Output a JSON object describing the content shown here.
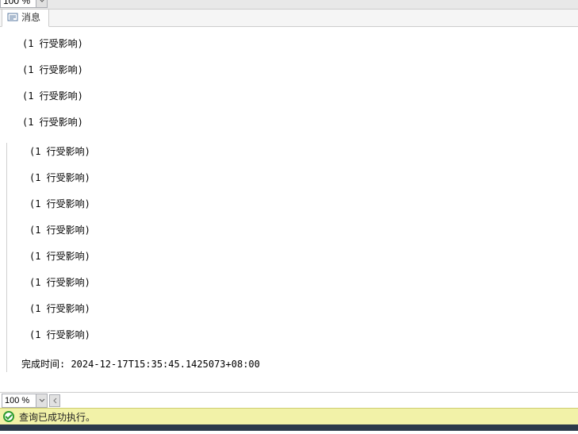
{
  "topZoom": {
    "value": "100 %"
  },
  "tab": {
    "label": "消息"
  },
  "messages": {
    "group1": [
      "(1 行受影响)",
      "(1 行受影响)",
      "(1 行受影响)",
      "(1 行受影响)"
    ],
    "group2": [
      "(1 行受影响)",
      "(1 行受影响)",
      "(1 行受影响)",
      "(1 行受影响)",
      "(1 行受影响)",
      "(1 行受影响)",
      "(1 行受影响)",
      "(1 行受影响)"
    ],
    "completion": "完成时间: 2024-12-17T15:35:45.1425073+08:00"
  },
  "lowerZoom": {
    "value": "100 %"
  },
  "status": {
    "text": "查询已成功执行。"
  }
}
